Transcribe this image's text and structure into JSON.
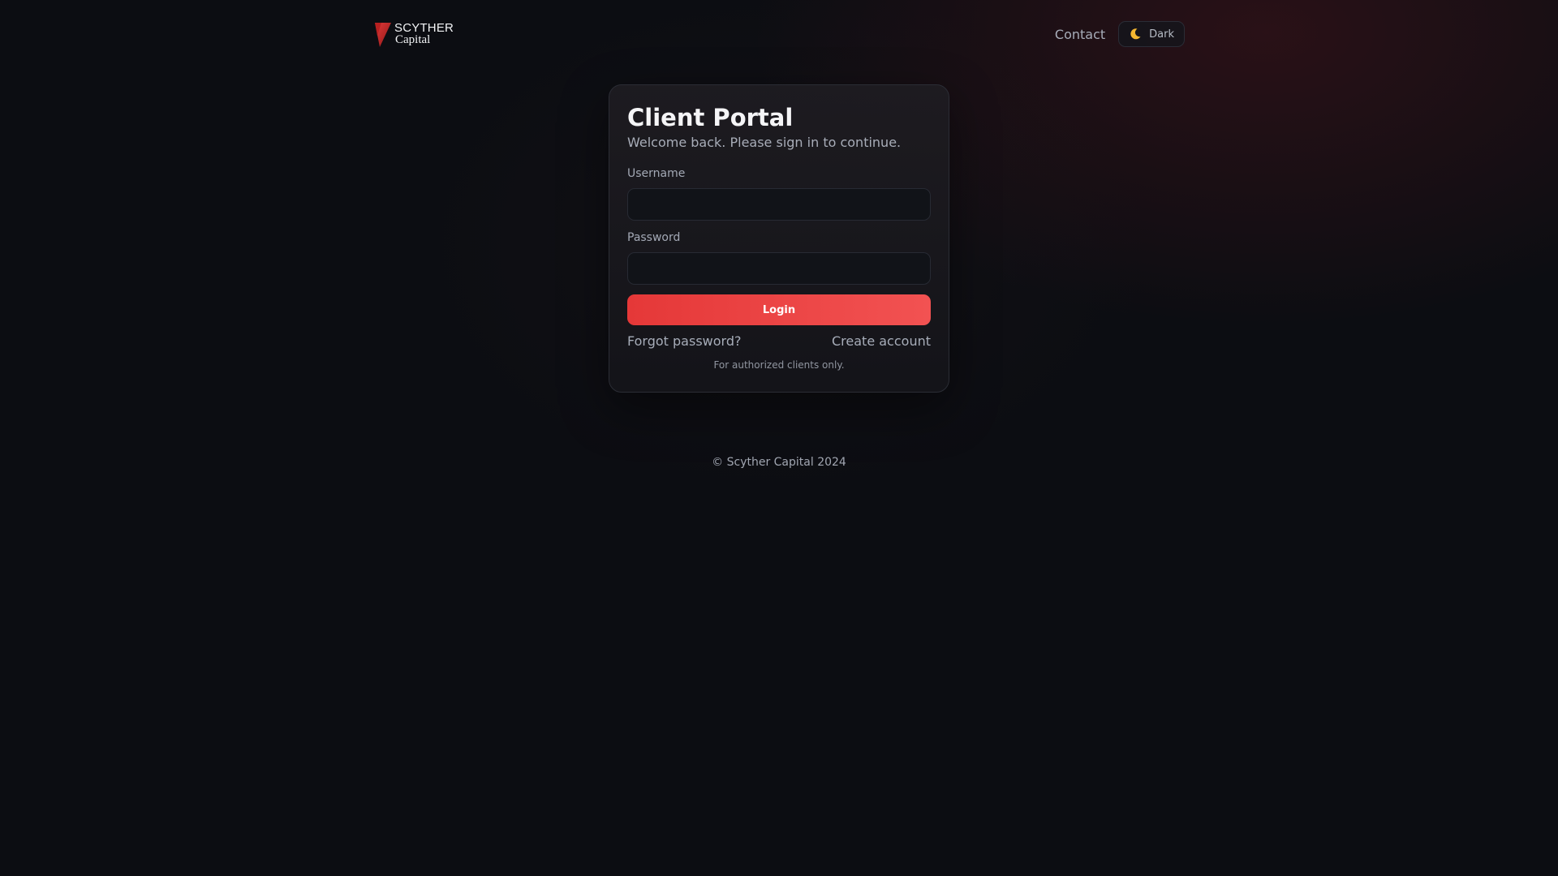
{
  "header": {
    "logo": {
      "line1": "SCYTHER",
      "line2": "Capital",
      "accent_color": "#d42a2a"
    },
    "nav": {
      "contact_label": "Contact"
    },
    "theme_toggle": {
      "icon": "moon-icon",
      "label": "Dark"
    }
  },
  "login_card": {
    "title": "Client Portal",
    "subtitle": "Welcome back. Please sign in to continue.",
    "username": {
      "label": "Username",
      "value": "",
      "placeholder": ""
    },
    "password": {
      "label": "Password",
      "value": "",
      "placeholder": ""
    },
    "login_button_label": "Login",
    "forgot_password_label": "Forgot password?",
    "create_account_label": "Create account",
    "disclaimer": "For authorized clients only."
  },
  "footer": {
    "copyright": "© Scyther Capital 2024"
  },
  "colors": {
    "background": "#0c0d12",
    "primary_button": "#ef4444",
    "card_border": "#2b2d35"
  }
}
